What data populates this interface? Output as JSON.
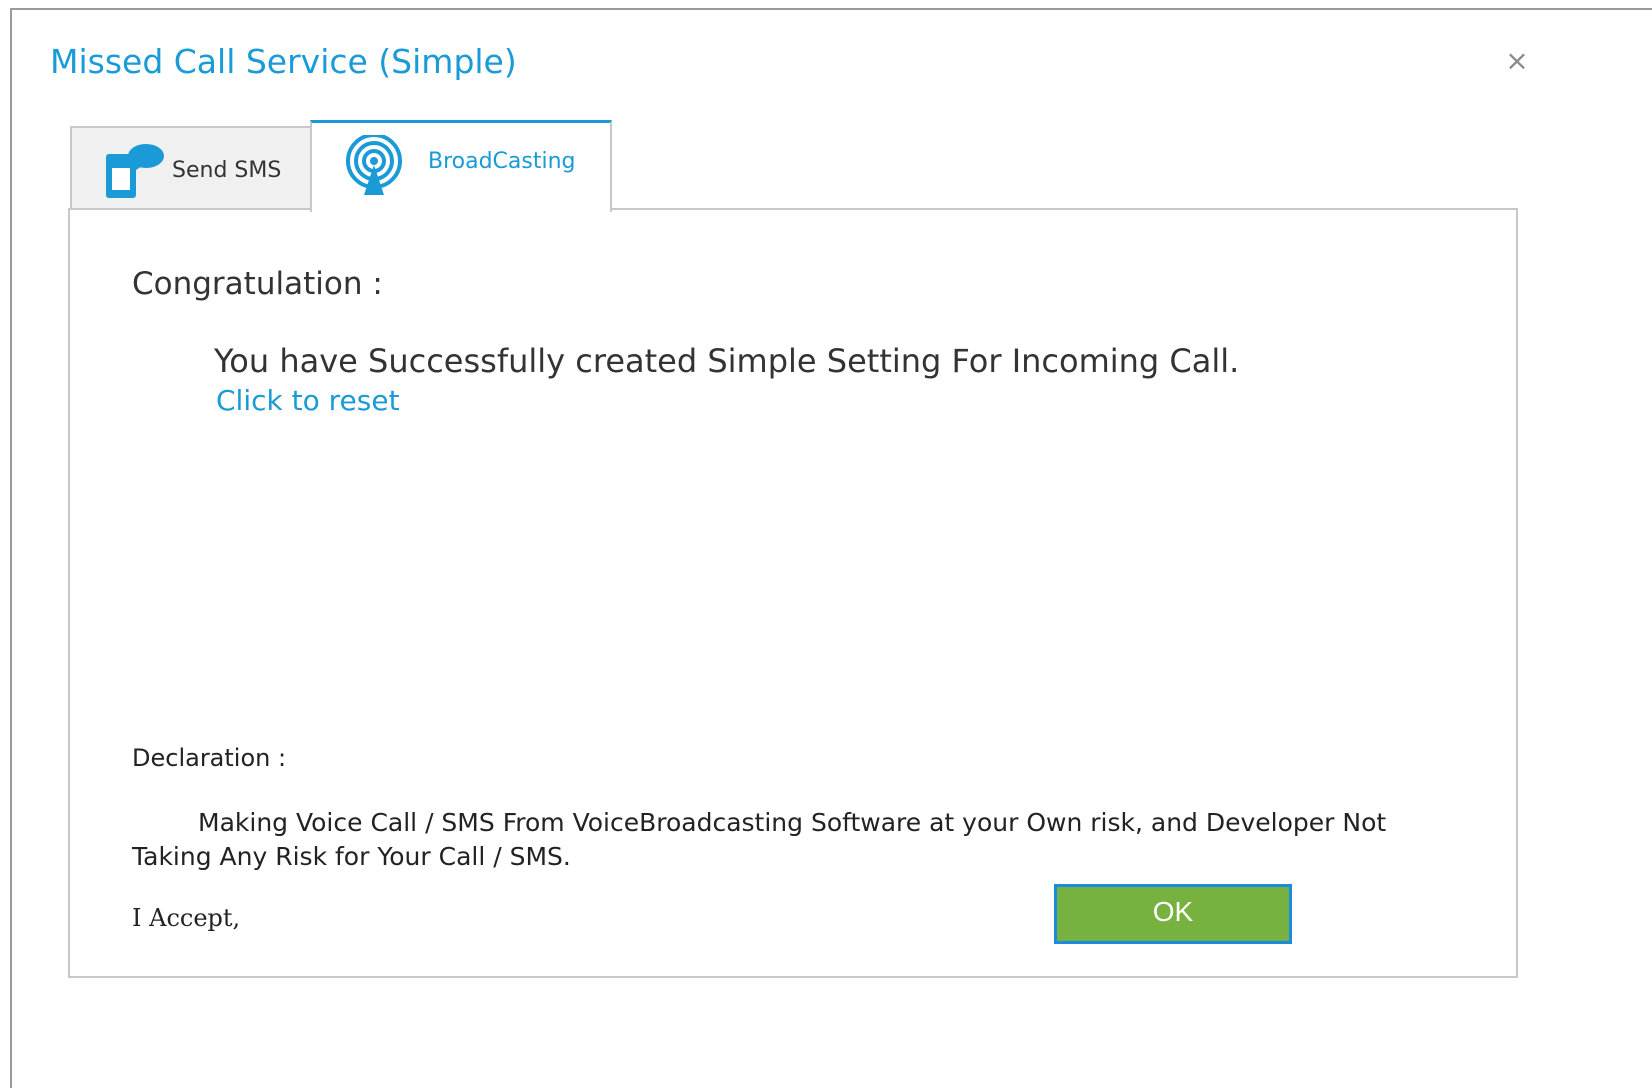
{
  "window": {
    "title": "Missed Call Service (Simple)",
    "close_glyph": "×"
  },
  "tabs": [
    {
      "label": "Send SMS",
      "icon": "phone-chat-icon",
      "active": false
    },
    {
      "label": "BroadCasting",
      "icon": "broadcast-icon",
      "active": true
    }
  ],
  "content": {
    "heading": "Congratulation :",
    "message": "You have Successfully created Simple Setting For Incoming Call.",
    "reset_link": "Click to reset"
  },
  "declaration": {
    "title": "Declaration :",
    "text": "Making Voice Call / SMS From VoiceBroadcasting Software at your Own risk, and Developer Not Taking Any Risk for Your Call / SMS.",
    "accept_label": "I Accept,"
  },
  "buttons": {
    "ok_label": "OK"
  },
  "colors": {
    "accent": "#1a9ad6",
    "ok_green": "#77b140",
    "ok_border": "#1a8ce0"
  }
}
